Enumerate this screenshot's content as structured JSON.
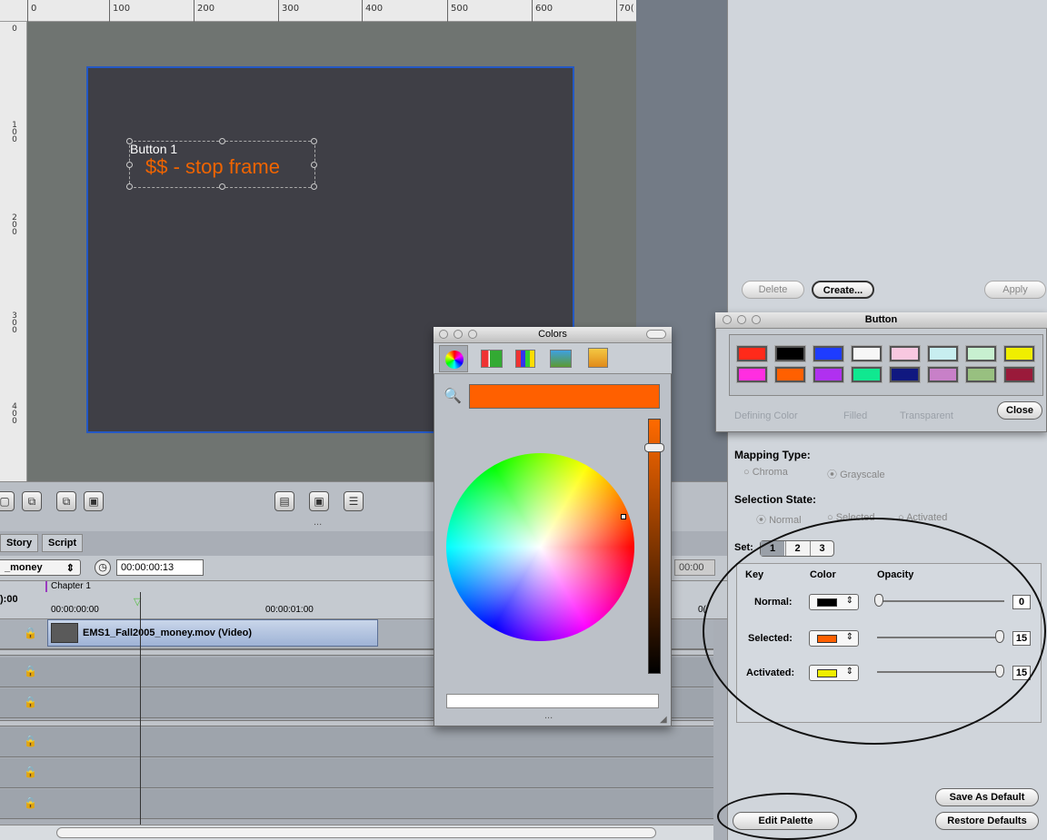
{
  "canvas": {
    "ruler_top": [
      "0",
      "100",
      "200",
      "300",
      "400",
      "500",
      "600",
      "70("
    ],
    "ruler_left": [
      [
        "0"
      ],
      [
        "1",
        "0",
        "0"
      ],
      [
        "2",
        "0",
        "0"
      ],
      [
        "3",
        "0",
        "0"
      ],
      [
        "4",
        "0",
        "0"
      ]
    ],
    "button_label": "Button 1",
    "button_text": "$$ - stop frame"
  },
  "toolbar": {
    "ellipsis": "..."
  },
  "timeline": {
    "tabs": [
      "Story",
      "Script"
    ],
    "track_menu": "_money",
    "timecode": "00:00:00:13",
    "timecode_right": "00:00",
    "chapter": "Chapter 1",
    "time_start": "00:00:00:00",
    "time_mid": "00:00:01:00",
    "time_left": "):00",
    "time_right": "0(",
    "clip_name": "EMS1_Fall2005_money.mov (Video)"
  },
  "colors_window": {
    "title": "Colors",
    "current_color": "#ff6000",
    "ellipsis": "..."
  },
  "button_palette": {
    "title": "Button",
    "swatches": [
      "#ff2a1a",
      "#000000",
      "#1e3cff",
      "#f7f7f7",
      "#f8c8e0",
      "#c8eef0",
      "#c8f0d0",
      "#f0ee00",
      "#ff2ee0",
      "#ff6000",
      "#b030f0",
      "#10e890",
      "#101880",
      "#c880c8",
      "#98c080",
      "#9a1a3a"
    ],
    "close_label": "Close",
    "bg_text_left": "Defining Color",
    "bg_text_mid": "Filled",
    "bg_text_right": "Transparent"
  },
  "inspector": {
    "delete_label": "Delete",
    "create_label": "Create...",
    "apply_label": "Apply",
    "mapping_type": "Mapping Type:",
    "mapping_options": [
      "Chroma",
      "Grayscale"
    ],
    "selection_state": "Selection State:",
    "state_options": [
      "Normal",
      "Selected",
      "Activated"
    ],
    "set_label": "Set:",
    "set_options": [
      "1",
      "2",
      "3"
    ],
    "table_headers": [
      "Key",
      "Color",
      "Opacity"
    ],
    "rows": [
      {
        "key": "Normal:",
        "color": "#000000",
        "opacity": "0"
      },
      {
        "key": "Selected:",
        "color": "#ff6000",
        "opacity": "15"
      },
      {
        "key": "Activated:",
        "color": "#f0ee00",
        "opacity": "15"
      }
    ],
    "save_default_label": "Save As Default",
    "edit_palette_label": "Edit Palette",
    "restore_defaults_label": "Restore Defaults"
  }
}
